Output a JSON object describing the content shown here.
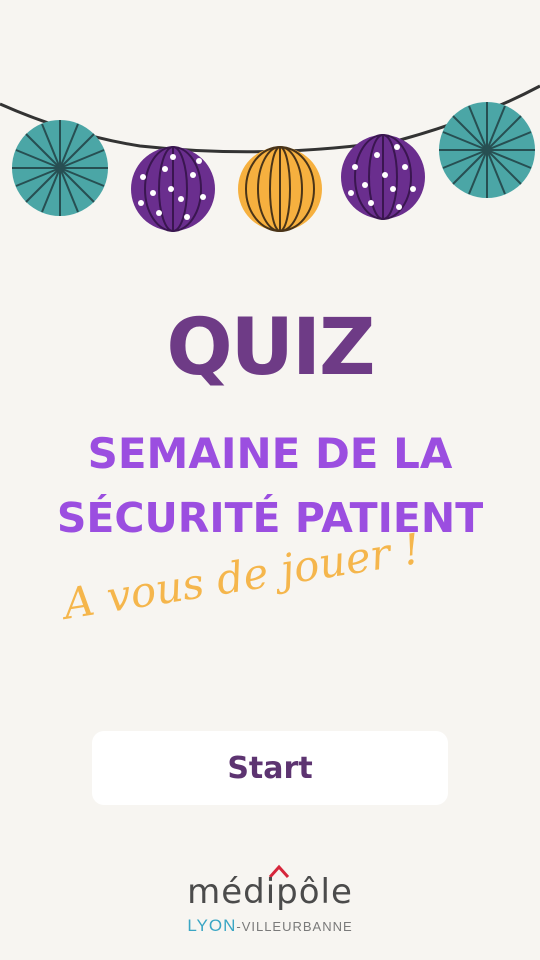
{
  "title": "QUIZ",
  "subtitle": {
    "line1": "SEMAINE DE LA",
    "line2": "SÉCURITÉ PATIENT"
  },
  "tagline": "A vous de jouer !",
  "start_button": {
    "label": "Start"
  },
  "logo": {
    "name": "médipôle",
    "city_part1": "LYON",
    "city_part2": "-VILLEURBANNE"
  },
  "colors": {
    "background": "#f7f5f1",
    "title": "#6e3b86",
    "subtitle": "#9b4ee0",
    "tagline": "#f5b64c",
    "teal": "#4ba6a6",
    "purple": "#6a2e8e",
    "yellow": "#f6b03f"
  },
  "decorations": [
    "garland-string",
    "teal-fan",
    "purple-lantern",
    "yellow-lantern",
    "purple-lantern",
    "teal-fan"
  ]
}
